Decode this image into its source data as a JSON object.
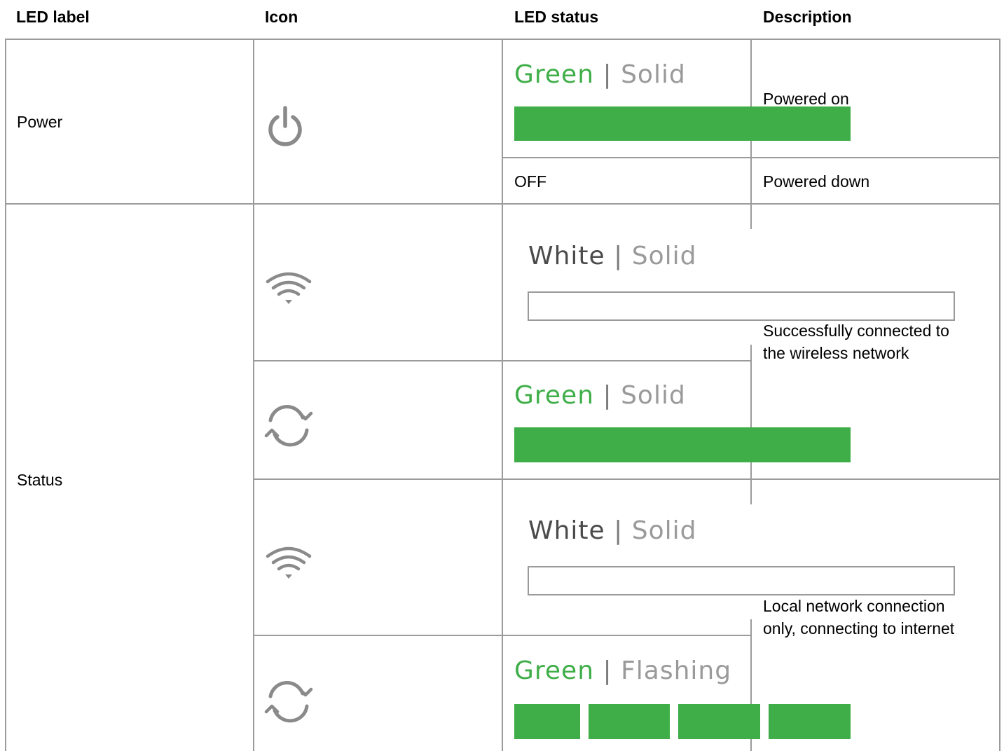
{
  "headers": {
    "led_label": "LED label",
    "icon": "Icon",
    "led_status": "LED status",
    "description": "Description"
  },
  "rows": {
    "power": {
      "label": "Power",
      "icon": "power-icon",
      "on": {
        "color_word": "Green",
        "separator": "|",
        "mode": "Solid",
        "description": "Powered on"
      },
      "off": {
        "status": "OFF",
        "description": "Powered down"
      }
    },
    "status": {
      "label": "Status",
      "group1": {
        "description_line1": "Successfully connected to",
        "description_line2": "the wireless network",
        "wifi": {
          "icon": "wifi-icon",
          "color_word": "White",
          "separator": "|",
          "mode": "Solid"
        },
        "sync": {
          "icon": "sync-icon",
          "color_word": "Green",
          "separator": "|",
          "mode": "Solid"
        }
      },
      "group2": {
        "description_line1": "Local network connection",
        "description_line2": "only, connecting to internet",
        "wifi": {
          "icon": "wifi-icon",
          "color_word": "White",
          "separator": "|",
          "mode": "Solid"
        },
        "sync": {
          "icon": "sync-icon",
          "color_word": "Green",
          "separator": "|",
          "mode": "Flashing"
        }
      }
    }
  },
  "colors": {
    "led_green": "#3fae49",
    "border_gray": "#9b9b9b",
    "icon_gray": "#8a8a8a"
  }
}
